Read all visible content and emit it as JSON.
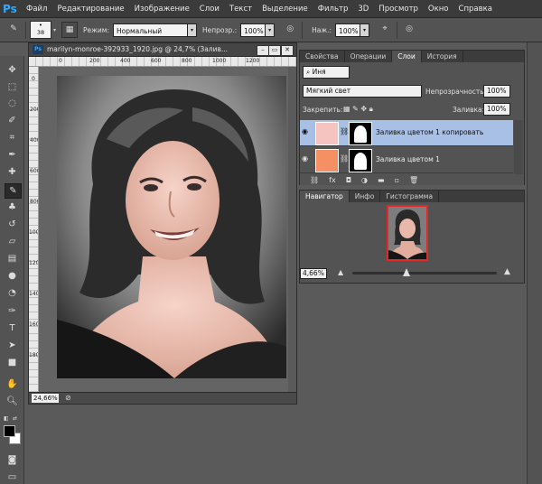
{
  "app": {
    "logo": "Ps"
  },
  "menu": [
    "Файл",
    "Редактирование",
    "Изображение",
    "Слои",
    "Текст",
    "Выделение",
    "Фильтр",
    "3D",
    "Просмотр",
    "Окно",
    "Справка"
  ],
  "options_bar": {
    "brush_size": "38",
    "mode_label": "Режим:",
    "mode_value": "Нормальный",
    "opacity_label": "Непрозр.:",
    "opacity_value": "100%",
    "flow_label": "Наж.:",
    "flow_value": "100%"
  },
  "document": {
    "title": "marilyn-monroe-392933_1920.jpg @ 24,7% (Залив...",
    "zoom": "24,66%",
    "ruler_top": [
      "0",
      "200",
      "400",
      "600",
      "800",
      "1000",
      "1200"
    ],
    "ruler_left": [
      "0",
      "200",
      "400",
      "600",
      "800",
      "1000",
      "1200",
      "1400",
      "1600",
      "1800"
    ]
  },
  "layers_panel": {
    "tabs": [
      "Свойства",
      "Операции",
      "Слои",
      "История"
    ],
    "active_tab": "Слои",
    "filter_label": "Иня",
    "blend_mode": "Мягкий свет",
    "opacity_label": "Непрозрачность:",
    "opacity_value": "100%",
    "lock_label": "Закрепить:",
    "fill_label": "Заливка:",
    "fill_value": "100%",
    "layers": [
      {
        "name": "Заливка цветом 1 копировать",
        "color": "#f5c4c0",
        "selected": true
      },
      {
        "name": "Заливка цветом 1",
        "color": "#f59065",
        "selected": false
      }
    ]
  },
  "navigator_panel": {
    "tabs": [
      "Навигатор",
      "Инфо",
      "Гистограмма"
    ],
    "active_tab": "Навигатор",
    "zoom": "4,66%"
  },
  "colors": {
    "accent_selected": "#a8bfe6",
    "nav_frame": "#e02a2a",
    "ps_blue": "#31a8ff"
  }
}
